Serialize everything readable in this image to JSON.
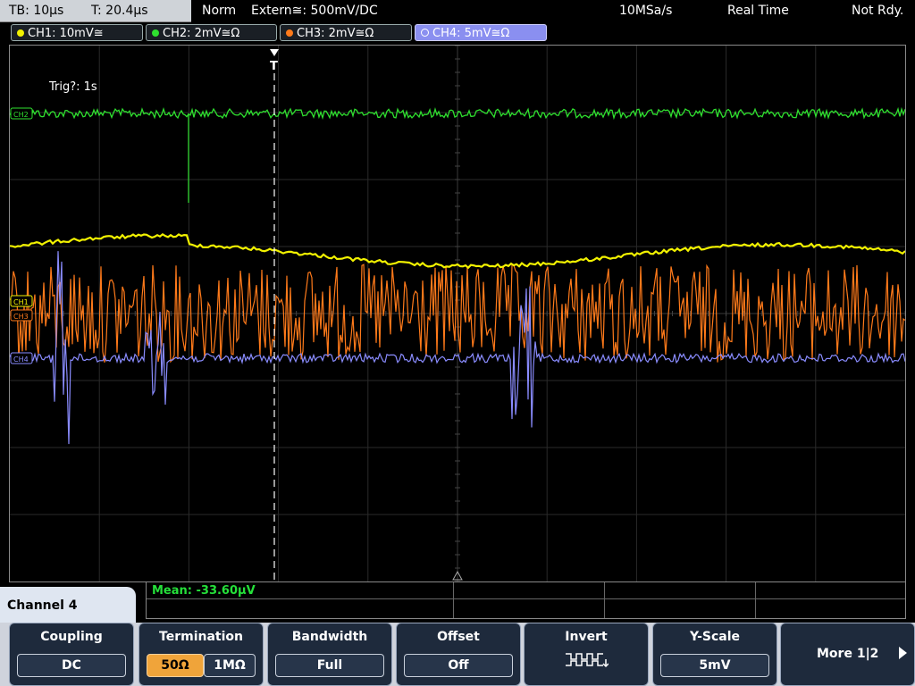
{
  "status": {
    "timebase": "TB: 10µs",
    "trigger_time": "T: 20.4µs",
    "mode": "Norm",
    "trigger_source": "Extern≅: 500mV∕DC",
    "sample_rate": "10MSa/s",
    "acquisition": "Real Time",
    "state": "Not Rdy."
  },
  "channels": [
    {
      "label": "CH1: 10mV≅",
      "color": "#f2f200",
      "active": false
    },
    {
      "label": "CH2: 2mV≅Ω",
      "color": "#2fe02f",
      "active": false
    },
    {
      "label": "CH3: 2mV≅Ω",
      "color": "#ff7a1a",
      "active": false
    },
    {
      "label": "CH4: 5mV≅Ω",
      "color": "#8a8cff",
      "active": true
    }
  ],
  "screen": {
    "trig_status": "Trig?: 1s",
    "trigger_marker": "T",
    "channel_markers": [
      "CH2",
      "CH1",
      "CH3",
      "CH4"
    ]
  },
  "measurement": {
    "text": "Mean: -33.60µV"
  },
  "menu": {
    "title": "Channel 4",
    "softkeys": [
      {
        "caption": "Coupling",
        "value": "DC"
      },
      {
        "caption": "Termination",
        "options": [
          "50Ω",
          "1MΩ"
        ],
        "selected": "50Ω"
      },
      {
        "caption": "Bandwidth",
        "value": "Full"
      },
      {
        "caption": "Offset",
        "value": "Off"
      },
      {
        "caption": "Invert",
        "icon": "invert-square-wave-icon"
      },
      {
        "caption": "Y-Scale",
        "value": "5mV"
      }
    ],
    "more": "More 1|2"
  }
}
